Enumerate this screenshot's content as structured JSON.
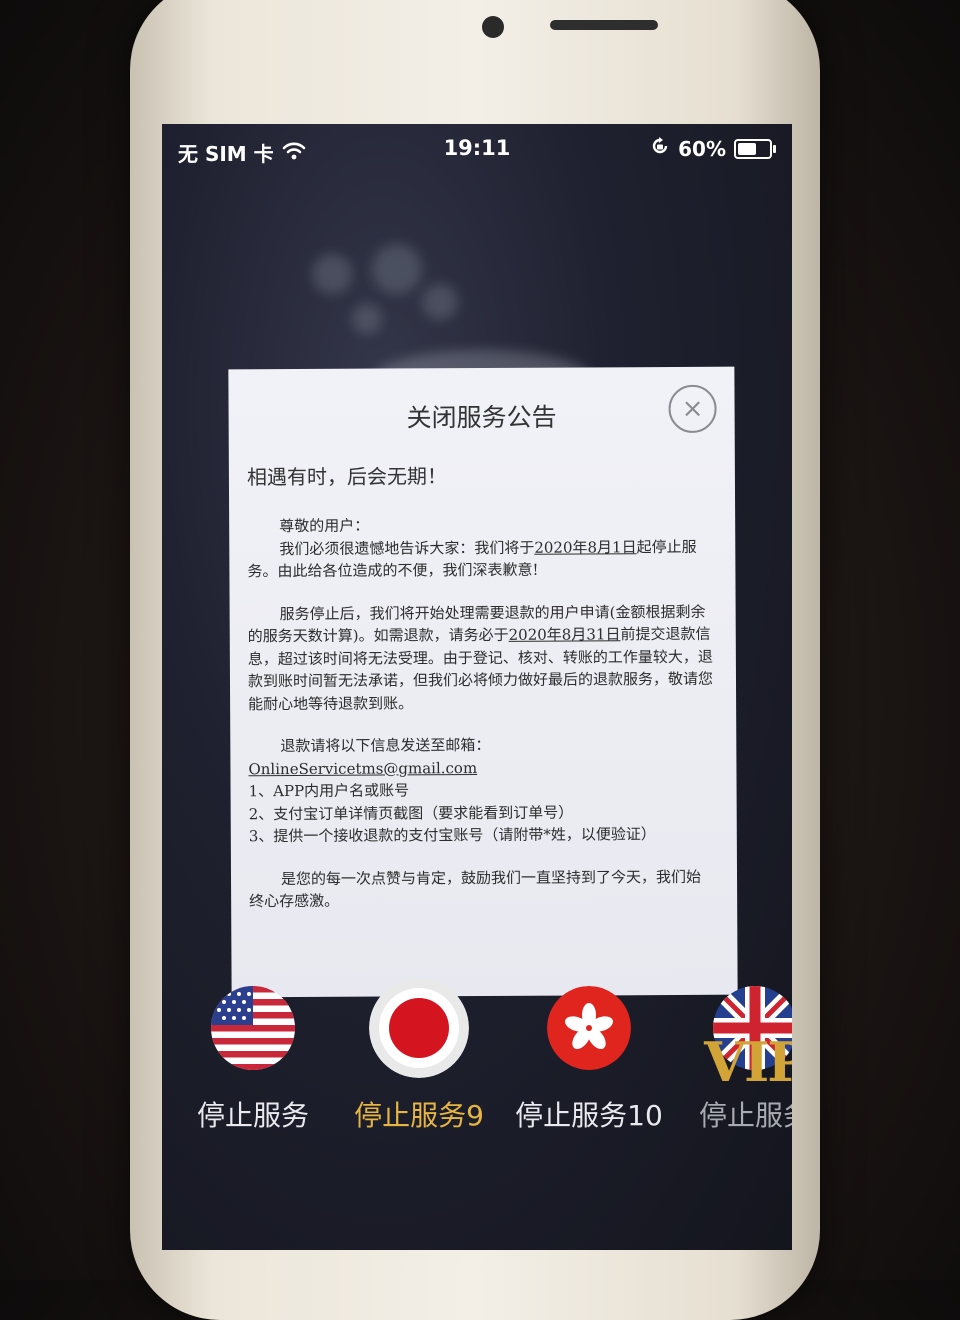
{
  "status_bar": {
    "carrier": "无 SIM 卡",
    "time": "19:11",
    "battery_percent": "60%",
    "battery_level": 0.6,
    "icons": [
      "wifi-icon",
      "orientation-lock-icon",
      "battery-icon"
    ]
  },
  "dialog": {
    "title": "关闭服务公告",
    "close_icon": "×",
    "heading": "相遇有时，后会无期！",
    "greeting": "尊敬的用户：",
    "para1_a": "我们必须很遗憾地告诉大家：我们将于",
    "para1_date": "2020年8月1日",
    "para1_b": "起停止服务。由此给各位造成的不便，我们深表歉意!",
    "para2_a": "服务停止后，我们将开始处理需要退款的用户申请(金额根据剩余的服务天数计算)。如需退款，请务必于",
    "para2_date": "2020年8月31日",
    "para2_b": "前提交退款信息，超过该时间将无法受理。由于登记、核对、转账的工作量较大，退款到账时间暂无法承诺，但我们必将倾力做好最后的退款服务，敬请您能耐心地等待退款到账。",
    "email_intro": "退款请将以下信息发送至邮箱：",
    "email": "OnlineServicetms@gmail.com",
    "list": [
      "1、APP内用户名或账号",
      "2、支付宝订单详情页截图（要求能看到订单号）",
      "3、提供一个接收退款的支付宝账号（请附带*姓，以便验证）"
    ],
    "closing": "是您的每一次点赞与肯定，鼓励我们一直坚持到了今天，我们始终心存感激。"
  },
  "services": [
    {
      "label": "停止服务",
      "icon": "us-flag-icon",
      "state": "normal"
    },
    {
      "label": "停止服务9",
      "icon": "japan-flag-icon",
      "state": "selected"
    },
    {
      "label": "停止服务10",
      "icon": "hong-kong-flag-icon",
      "state": "normal"
    },
    {
      "label": "停止服务",
      "icon": "uk-flag-icon",
      "badge": "VIP",
      "state": "dim"
    }
  ],
  "colors": {
    "selected_label": "#e6b542",
    "vip_gold": "#d2a437",
    "screen_bg": "#1f2130",
    "dialog_bg": "#eeeff4"
  }
}
